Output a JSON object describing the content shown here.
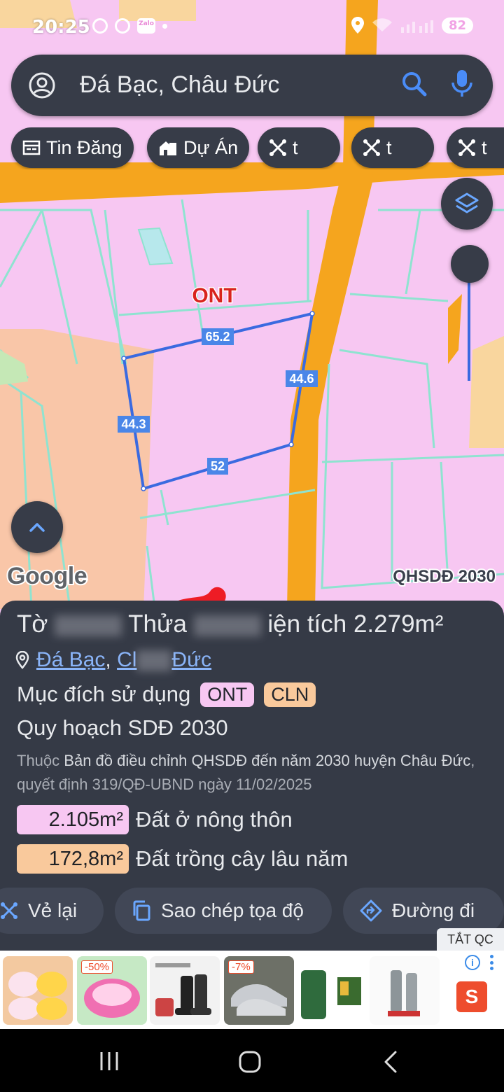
{
  "status_bar": {
    "time": "20:25",
    "app_icons": [
      "navigation-icon",
      "facebook-icon",
      "zalo-icon",
      "dot-icon"
    ],
    "zalo_label": "Zalo",
    "battery": "82"
  },
  "search": {
    "query": "Đá Bạc, Châu Đức"
  },
  "chips": [
    {
      "label": "Tin Đăng",
      "icon": "listing-icon"
    },
    {
      "label": "Dự Án",
      "icon": "buildings-icon"
    },
    {
      "label": "t",
      "icon": "measure-icon"
    },
    {
      "label": "t",
      "icon": "measure-icon"
    },
    {
      "label": "t",
      "icon": "measure-icon"
    }
  ],
  "map": {
    "zone_label": "ONT",
    "edge_lengths": [
      "65.2",
      "44.6",
      "44.3",
      "52"
    ],
    "logo": "Google",
    "layer_label": "QHSDĐ 2030",
    "colors": {
      "residential": "#f7c7f2",
      "perennial": "#f9c6a8",
      "road": "#f5a51e",
      "parcel_line": "#8fe3d0",
      "boundary": "#3a6ae0"
    }
  },
  "panel": {
    "title_prefix": "Tờ",
    "title_middle": "Thửa",
    "title_suffix": "iện tích 2.279m²",
    "location_part1": "Đá Bạc",
    "location_sep": ", ",
    "location_part2": "Cl",
    "location_part3": "Đức",
    "purpose_label": "Mục đích sử dụng",
    "purpose_tags": [
      {
        "code": "ONT",
        "color": "#f7c7f2"
      },
      {
        "code": "CLN",
        "color": "#f9c99c"
      }
    ],
    "plan_title": "Quy hoạch SDĐ 2030",
    "desc_prefix": "Thuộc",
    "desc_main": "Bản đồ điều chỉnh QHSDĐ đến năm 2030 huyện Châu Đức",
    "desc_suffix": ", quyết định 319/QĐ-UBND ngày 11/02/2025",
    "areas": [
      {
        "value": "2.105m²",
        "label": "Đất ở nông thôn",
        "color": "#f7c7f2"
      },
      {
        "value": "172,8m²",
        "label": "Đất trồng cây lâu năm",
        "color": "#f9c99c"
      }
    ]
  },
  "actions": [
    {
      "label": "Vẻ lại",
      "icon": "measure-icon"
    },
    {
      "label": "Sao chép tọa độ",
      "icon": "copy-icon"
    },
    {
      "label": "Đường đi",
      "icon": "directions-icon"
    }
  ],
  "ads": {
    "close_label": "TẮT QC",
    "badges": [
      "-50%",
      "-7%"
    ],
    "store_label": "S"
  }
}
